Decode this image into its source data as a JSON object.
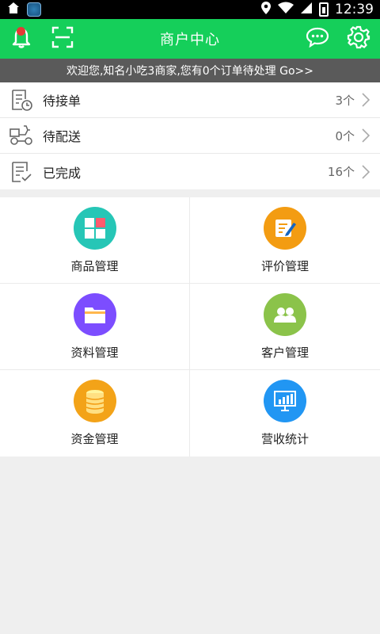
{
  "status_bar": {
    "time": "12:39",
    "icons": [
      "home-icon",
      "app-icon",
      "location-icon",
      "wifi-icon",
      "signal-icon",
      "battery-icon"
    ]
  },
  "header": {
    "title": "商户中心",
    "left_icons": [
      "bell-icon",
      "scan-icon"
    ],
    "right_icons": [
      "chat-icon",
      "gear-icon"
    ],
    "accent_color": "#15cf5a",
    "badge_color": "#e53935"
  },
  "notice": {
    "text": "欢迎您,知名小吃3商家,您有0个订单待处理 Go>>"
  },
  "orders": [
    {
      "label": "待接单",
      "count": "3个",
      "icon": "pending-order-icon"
    },
    {
      "label": "待配送",
      "count": "0个",
      "icon": "delivery-scooter-icon"
    },
    {
      "label": "已完成",
      "count": "16个",
      "icon": "completed-order-icon"
    }
  ],
  "menu": [
    {
      "label": "商品管理",
      "icon": "product-management-icon",
      "color": "#26c6b6"
    },
    {
      "label": "评价管理",
      "icon": "review-management-icon",
      "color": "#f39c12"
    },
    {
      "label": "资料管理",
      "icon": "profile-management-icon",
      "color": "#7c4dff"
    },
    {
      "label": "客户管理",
      "icon": "customer-management-icon",
      "color": "#8bc34a"
    },
    {
      "label": "资金管理",
      "icon": "funds-management-icon",
      "color": "#f3a318"
    },
    {
      "label": "营收统计",
      "icon": "revenue-statistics-icon",
      "color": "#2196f3"
    }
  ]
}
